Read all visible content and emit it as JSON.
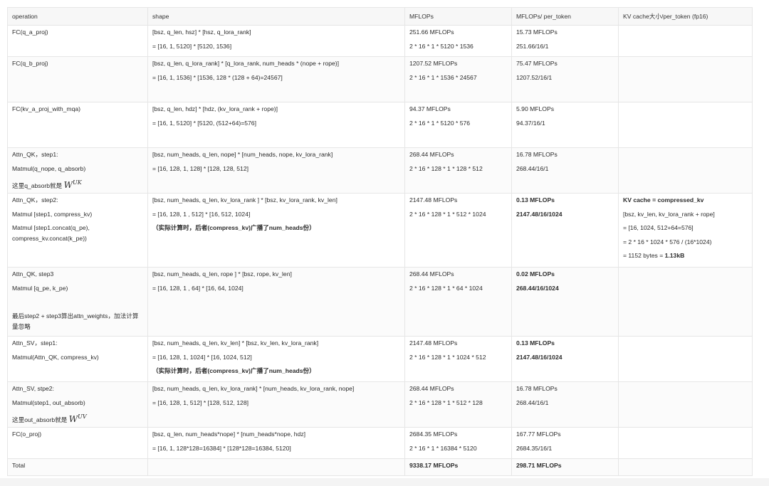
{
  "columns": [
    "operation",
    "shape",
    "MFLOPs",
    "MFLOPs/ per_token",
    "KV cache大小/per_token (fp16)"
  ],
  "rows": [
    {
      "operation": [
        "FC(q_a_proj)"
      ],
      "shape": [
        "[bsz, q_len, hsz] * [hsz, q_lora_rank]",
        "= [16, 1, 5120] * [5120, 1536]"
      ],
      "mflops": [
        "251.66 MFLOPs",
        "2 * 16 * 1 * 5120 * 1536"
      ],
      "per_token": [
        "15.73 MFLOPs",
        "251.66/16/1"
      ],
      "kv": []
    },
    {
      "operation": [
        "FC(q_b_proj)"
      ],
      "shape": [
        "[bsz, q_len, q_lora_rank] * [q_lora_rank, num_heads * (nope + rope)]",
        "= [16, 1, 1536] * [1536, 128 * (128 + 64)=24567]"
      ],
      "mflops": [
        "1207.52 MFLOPs",
        "2 * 16 * 1 * 1536 * 24567"
      ],
      "per_token": [
        "75.47 MFLOPs",
        "1207.52/16/1"
      ],
      "kv": []
    },
    {
      "operation": [
        "FC(kv_a_proj_with_mqa)"
      ],
      "shape": [
        "[bsz, q_len, hdz] * [hdz, (kv_lora_rank + rope)]",
        "= [16, 1, 5120] * [5120, (512+64)=576]"
      ],
      "mflops": [
        "94.37 MFLOPs",
        "2 * 16 * 1 * 5120 * 576"
      ],
      "per_token": [
        "5.90 MFLOPs",
        "94.37/16/1"
      ],
      "kv": []
    },
    {
      "operation": [
        "Attn_QK，step1:",
        "Matmul(q_nope, q_absorb)"
      ],
      "operation_math_prefix": "这里q_absorb就是",
      "operation_math_var": "W",
      "operation_math_sup": "UK",
      "shape": [
        "[bsz, num_heads, q_len, nope] * [num_heads, nope, kv_lora_rank]",
        "= [16, 128, 1, 128] * [128, 128, 512]"
      ],
      "mflops": [
        "268.44 MFLOPs",
        " 2 * 16 * 128 * 1 * 128 * 512"
      ],
      "per_token": [
        "16.78 MFLOPs",
        "268.44/16/1"
      ],
      "kv": []
    },
    {
      "operation": [
        "Attn_QK，step2:",
        "Matmul [step1, compress_kv)",
        "Matmul [step1.concat(q_pe), compress_kv.concat(k_pe))"
      ],
      "shape": [
        "[bsz, num_heads, q_len, kv_lora_rank ] * [bsz, kv_lora_rank, kv_len]",
        "= [16, 128, 1 , 512] * [16, 512, 1024]",
        "（实际计算时，后者(compress_kv)广播了num_heads份）"
      ],
      "mflops": [
        "2147.48 MFLOPs",
        "2 * 16 * 128 * 1 * 512 * 1024"
      ],
      "per_token": [
        "0.13 MFLOPs",
        "2147.48/16/1024"
      ],
      "kv": [
        "KV cache = compressed_kv",
        "[bsz, kv_len, kv_lora_rank + rope]",
        "= [16, 1024, 512+64=576]",
        "= 2 * 16 * 1024 * 576 / (16*1024)",
        "= 1152 bytes = ",
        "1.13kB"
      ]
    },
    {
      "operation": [
        "Attn_QK, step3",
        "Matmul [q_pe, k_pe)",
        "最后step2 + step3算出attn_weights，加法计算量忽略"
      ],
      "shape": [
        "[bsz, num_heads, q_len, rope ] * [bsz, rope, kv_len]",
        "= [16, 128, 1 , 64] * [16, 64, 1024]"
      ],
      "mflops": [
        "268.44 MFLOPs",
        "2 * 16 * 128 * 1 * 64 * 1024"
      ],
      "per_token": [
        "0.02 MFLOPs",
        "268.44/16/1024"
      ],
      "kv": []
    },
    {
      "operation": [
        "Attn_SV，step1:",
        "Matmul(Attn_QK, compress_kv)"
      ],
      "shape": [
        "[bsz, num_heads, q_len, kv_len] * [bsz, kv_len, kv_lora_rank]",
        "= [16, 128, 1, 1024] * [16, 1024, 512]",
        "（实际计算时，后者(compress_kv)广播了num_heads份）"
      ],
      "mflops": [
        "2147.48 MFLOPs",
        "2 * 16 * 128 * 1 * 1024 * 512"
      ],
      "per_token": [
        "0.13 MFLOPs",
        "2147.48/16/1024"
      ],
      "kv": []
    },
    {
      "operation": [
        "Attn_SV, stpe2:",
        "Matmul(step1, out_absorb)"
      ],
      "operation_math_prefix": "这里out_absorb就是",
      "operation_math_var": "W",
      "operation_math_sup": "UV",
      "shape": [
        "[bsz, num_heads, q_len, kv_lora_rank] * [num_heads, kv_lora_rank, nope]",
        "= [16, 128, 1, 512] * [128, 512, 128]"
      ],
      "mflops": [
        "268.44 MFLOPs",
        "2 * 16 * 128 * 1 * 512 * 128"
      ],
      "per_token": [
        "16.78 MFLOPs",
        "268.44/16/1"
      ],
      "kv": []
    },
    {
      "operation": [
        "FC(o_proj)"
      ],
      "shape": [
        "[bsz, q_len, num_heads*nope] * [num_heads*nope, hdz]",
        "= [16, 1, 128*128=16384] * [128*128=16384, 5120]"
      ],
      "mflops": [
        "2684.35 MFLOPs",
        "2 * 16 * 1 * 16384 * 5120"
      ],
      "per_token": [
        "167.77 MFLOPs",
        "2684.35/16/1"
      ],
      "kv": []
    }
  ],
  "total": {
    "label": "Total",
    "mflops": "9338.17 MFLOPs",
    "per_token": "298.71 MFLOPs"
  }
}
